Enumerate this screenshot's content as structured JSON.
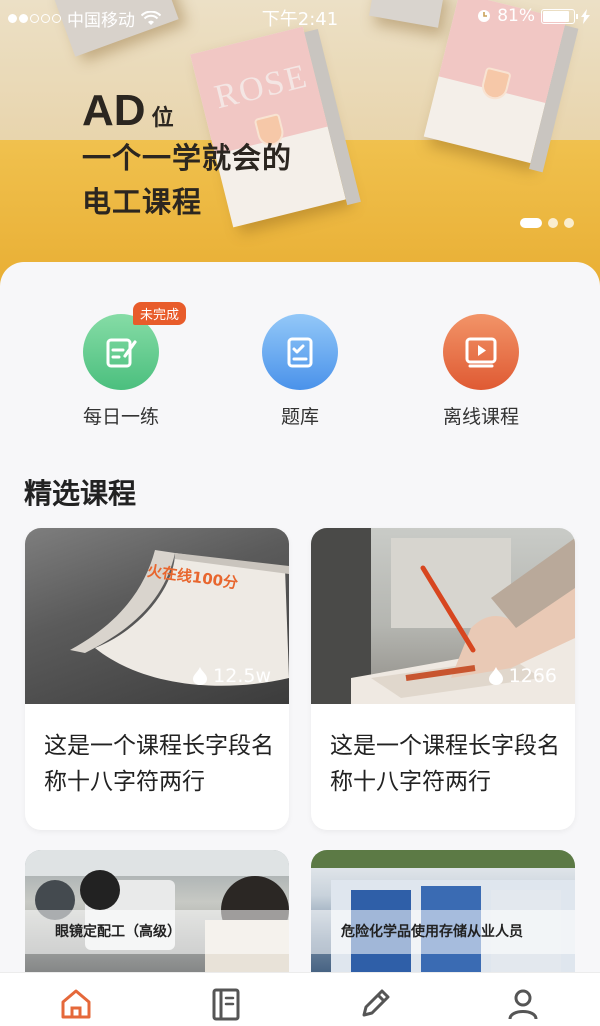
{
  "status_bar": {
    "carrier": "中国移动",
    "time": "下午2:41",
    "battery": "81%",
    "battery_level": 0.81
  },
  "banner": {
    "headline_big": "AD",
    "headline_small": "位",
    "line1": "一个一学就会的",
    "line2": "电工课程",
    "book_word": "ROSE",
    "carousel_count": 3,
    "carousel_active": 0
  },
  "quick_actions": [
    {
      "label": "每日一练",
      "badge": "未完成",
      "icon": "daily-practice-icon",
      "color_from": "#7ed7a0",
      "color_to": "#4cc07f"
    },
    {
      "label": "题库",
      "icon": "question-bank-icon",
      "color_from": "#8cc2f7",
      "color_to": "#4a93ec"
    },
    {
      "label": "离线课程",
      "icon": "offline-course-icon",
      "color_from": "#f08c62",
      "color_to": "#e15e36"
    }
  ],
  "section": {
    "title": "精选课程"
  },
  "courses": [
    {
      "title": "这是一个课程长字段名称十八字符两行",
      "views": "12.5w",
      "image_text": "火在线100分"
    },
    {
      "title": "这是一个课程长字段名称十八字符两行",
      "views": "1266"
    }
  ],
  "more_courses": [
    {
      "title": "眼镜定配工（高级）"
    },
    {
      "title": "危险化学品使用存储从业人员"
    }
  ],
  "tab_bar": {
    "items": [
      "home-icon",
      "notebook-icon",
      "pencil-icon",
      "profile-icon"
    ],
    "active_color": "#e5683a",
    "inactive_color": "#555555"
  }
}
